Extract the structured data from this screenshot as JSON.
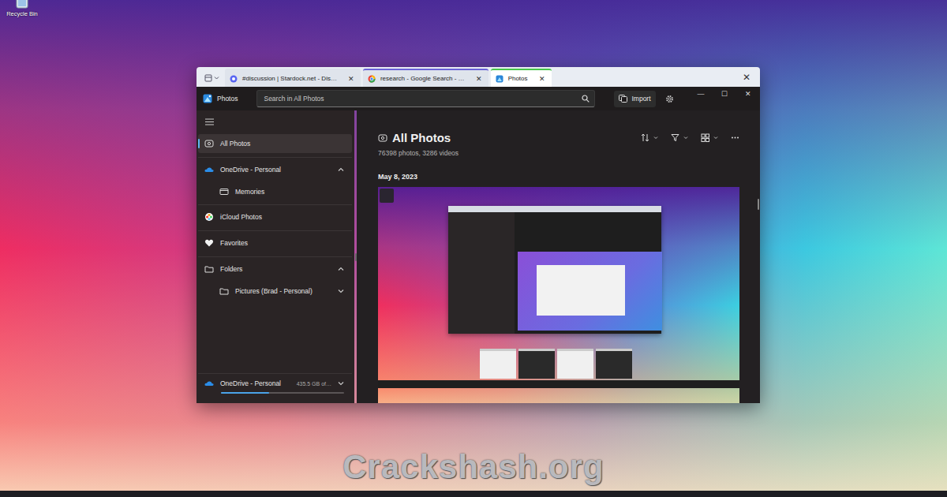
{
  "desktop": {
    "icons": [
      {
        "label": "Recycle Bin"
      }
    ]
  },
  "window": {
    "tabs": [
      {
        "label": "#discussion | Stardock.net - Dis…",
        "close": "✕",
        "selected": false,
        "color": "#dfe4ec"
      },
      {
        "label": "research - Google Search - …",
        "close": "✕",
        "selected": false,
        "color": "#6b63d8"
      },
      {
        "label": "Photos",
        "close": "✕",
        "selected": true,
        "color": "#49c54a"
      }
    ],
    "close": "✕"
  },
  "app": {
    "title": "Photos",
    "search": {
      "placeholder": "Search in All Photos"
    },
    "import": "Import",
    "controls": [
      "—",
      "☐",
      "✕"
    ]
  },
  "sidebar": {
    "items": [
      {
        "label": "All Photos",
        "kind": "item",
        "selected": true
      },
      {
        "label": "OneDrive - Personal",
        "kind": "item",
        "selected": false,
        "expanded": true
      },
      {
        "label": "Memories",
        "kind": "sub",
        "selected": false
      },
      {
        "label": "iCloud Photos",
        "kind": "item",
        "selected": false
      },
      {
        "label": "Favorites",
        "kind": "item",
        "selected": false
      },
      {
        "label": "Folders",
        "kind": "item",
        "selected": false,
        "expanded": true
      },
      {
        "label": "Pictures (Brad - Personal)",
        "kind": "sub",
        "selected": false,
        "expanded": false
      }
    ],
    "storage": {
      "label": "OneDrive - Personal",
      "reading": "435.5 GB of…",
      "level": 0.39,
      "expanded": false
    }
  },
  "main": {
    "heading": "All Photos",
    "count": "76398 photos, 3286 videos",
    "groups": [
      {
        "date": "May 8, 2023"
      }
    ]
  },
  "watermark": "Crackshash.org"
}
